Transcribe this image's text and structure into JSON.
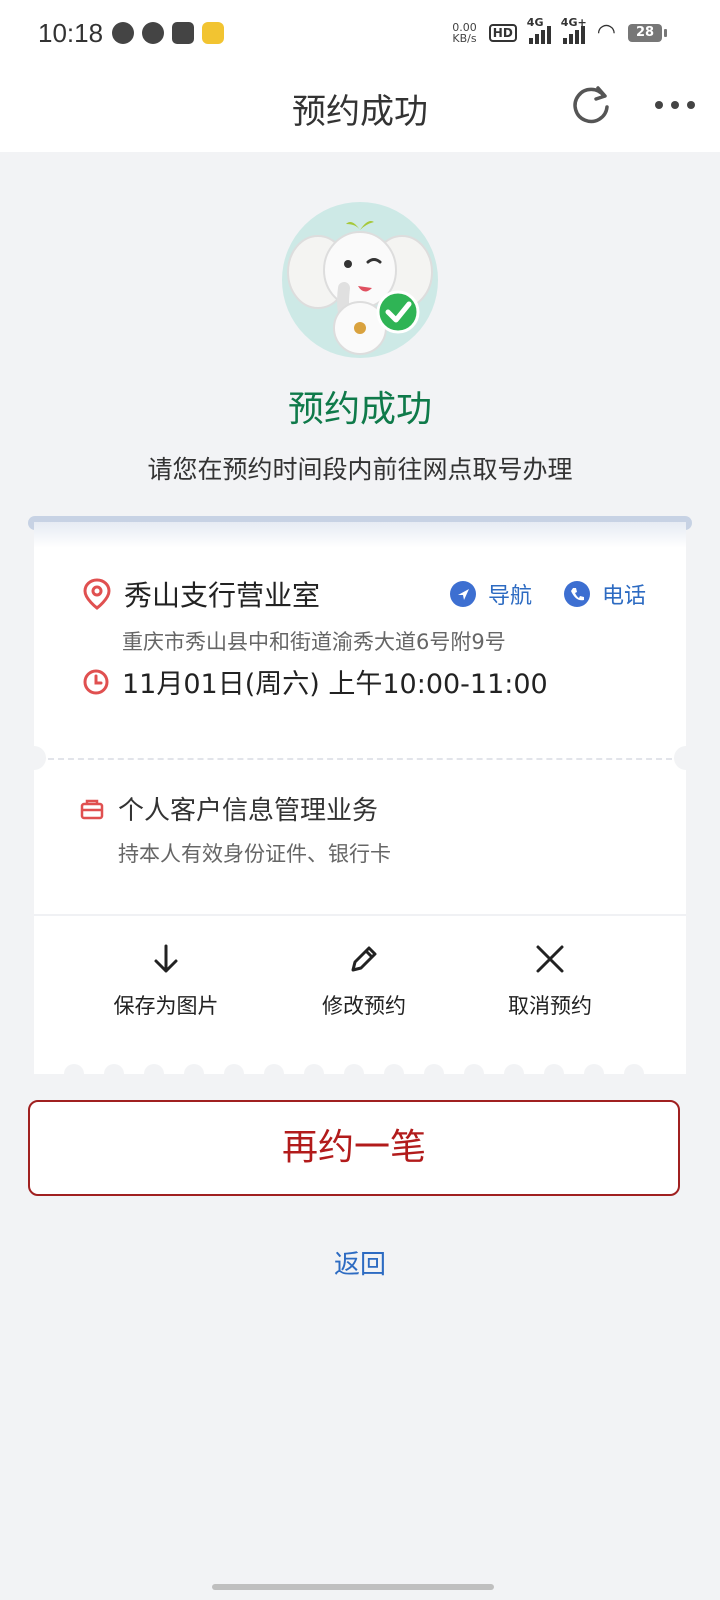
{
  "status_bar": {
    "time": "10:18",
    "net_speed_value": "0.00",
    "net_speed_unit": "KB/s",
    "hd_label": "HD",
    "signal1_label": "4G",
    "signal2_label": "4G+",
    "battery": "28"
  },
  "header": {
    "title": "预约成功"
  },
  "hero": {
    "title": "预约成功",
    "subtitle": "请您在预约时间段内前往网点取号办理"
  },
  "appointment": {
    "branch_name": "秀山支行营业室",
    "navigate_label": "导航",
    "phone_label": "电话",
    "address": "重庆市秀山县中和街道渝秀大道6号附9号",
    "time": "11月01日(周六) 上午10:00-11:00",
    "service_name": "个人客户信息管理业务",
    "service_requirements": "持本人有效身份证件、银行卡"
  },
  "actions": {
    "save_label": "保存为图片",
    "modify_label": "修改预约",
    "cancel_label": "取消预约"
  },
  "buttons": {
    "again_label": "再约一笔",
    "back_label": "返回"
  },
  "colors": {
    "success_green": "#0f7a4a",
    "accent_red": "#b21b1b",
    "link_blue": "#2d6bc2"
  }
}
